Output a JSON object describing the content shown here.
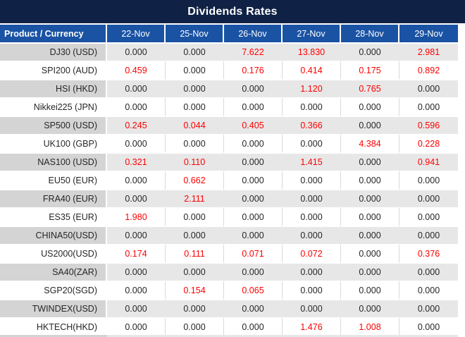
{
  "title": "Dividends Rates",
  "colors": {
    "title_bg": "#0f2145",
    "header_bg": "#1a53a4",
    "positive_value_red": "#fe0000",
    "value_text": "#262626",
    "striped_product_bg": "#d4d4d4",
    "striped_value_bg": "#e7e7e7"
  },
  "table": {
    "columns": [
      "Product / Currency",
      "22-Nov",
      "25-Nov",
      "26-Nov",
      "27-Nov",
      "28-Nov",
      "29-Nov"
    ],
    "rows": [
      {
        "product": "DJ30 (USD)",
        "values": [
          "0.000",
          "0.000",
          "7.622",
          "13.830",
          "0.000",
          "2.981"
        ]
      },
      {
        "product": "SPI200 (AUD)",
        "values": [
          "0.459",
          "0.000",
          "0.176",
          "0.414",
          "0.175",
          "0.892"
        ]
      },
      {
        "product": "HSI (HKD)",
        "values": [
          "0.000",
          "0.000",
          "0.000",
          "1.120",
          "0.765",
          "0.000"
        ]
      },
      {
        "product": "Nikkei225 (JPN)",
        "values": [
          "0.000",
          "0.000",
          "0.000",
          "0.000",
          "0.000",
          "0.000"
        ]
      },
      {
        "product": "SP500 (USD)",
        "values": [
          "0.245",
          "0.044",
          "0.405",
          "0.366",
          "0.000",
          "0.596"
        ]
      },
      {
        "product": "UK100 (GBP)",
        "values": [
          "0.000",
          "0.000",
          "0.000",
          "0.000",
          "4.384",
          "0.228"
        ]
      },
      {
        "product": "NAS100 (USD)",
        "values": [
          "0.321",
          "0.110",
          "0.000",
          "1.415",
          "0.000",
          "0.941"
        ]
      },
      {
        "product": "EU50 (EUR)",
        "values": [
          "0.000",
          "0.662",
          "0.000",
          "0.000",
          "0.000",
          "0.000"
        ]
      },
      {
        "product": "FRA40 (EUR)",
        "values": [
          "0.000",
          "2.111",
          "0.000",
          "0.000",
          "0.000",
          "0.000"
        ]
      },
      {
        "product": "ES35 (EUR)",
        "values": [
          "1.980",
          "0.000",
          "0.000",
          "0.000",
          "0.000",
          "0.000"
        ]
      },
      {
        "product": "CHINA50(USD)",
        "values": [
          "0.000",
          "0.000",
          "0.000",
          "0.000",
          "0.000",
          "0.000"
        ]
      },
      {
        "product": "US2000(USD)",
        "values": [
          "0.174",
          "0.111",
          "0.071",
          "0.072",
          "0.000",
          "0.376"
        ]
      },
      {
        "product": "SA40(ZAR)",
        "values": [
          "0.000",
          "0.000",
          "0.000",
          "0.000",
          "0.000",
          "0.000"
        ]
      },
      {
        "product": "SGP20(SGD)",
        "values": [
          "0.000",
          "0.154",
          "0.065",
          "0.000",
          "0.000",
          "0.000"
        ]
      },
      {
        "product": "TWINDEX(USD)",
        "values": [
          "0.000",
          "0.000",
          "0.000",
          "0.000",
          "0.000",
          "0.000"
        ]
      },
      {
        "product": "HKTECH(HKD)",
        "values": [
          "0.000",
          "0.000",
          "0.000",
          "1.476",
          "1.008",
          "0.000"
        ]
      }
    ]
  }
}
